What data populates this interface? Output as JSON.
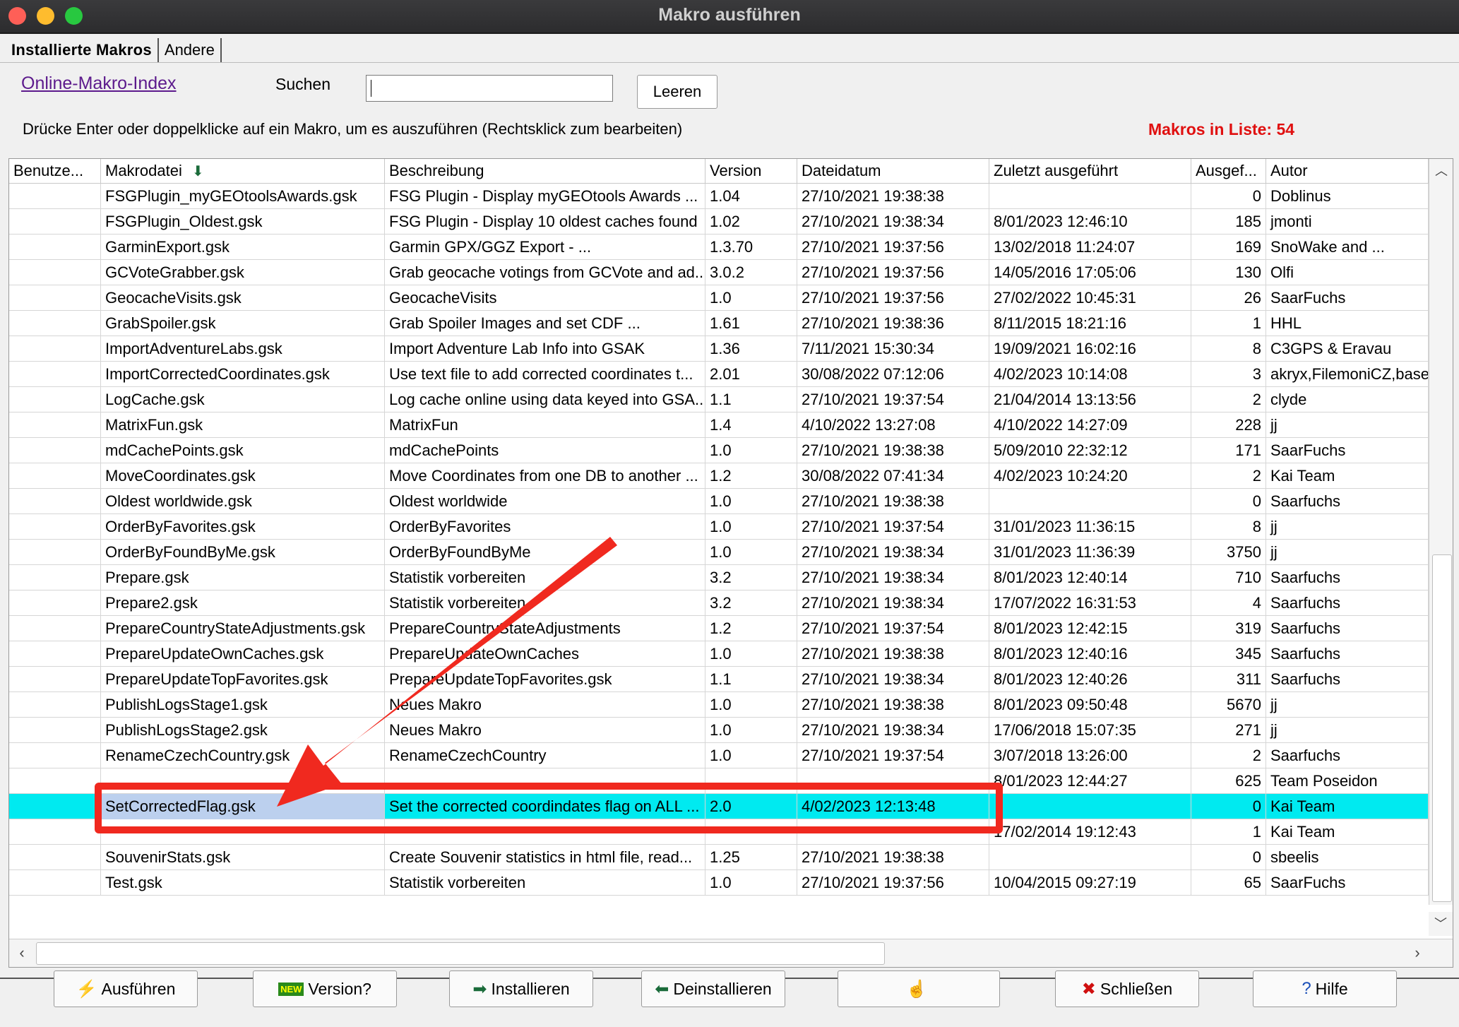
{
  "window": {
    "title": "Makro ausführen"
  },
  "tabs": [
    {
      "label": "Installierte Makros"
    },
    {
      "label": "Andere"
    }
  ],
  "online_link": "Online-Makro-Index",
  "search": {
    "label": "Suchen",
    "value": "",
    "clear_label": "Leeren"
  },
  "hint": "Drücke Enter oder doppelklicke auf ein Makro, um es auszuführen (Rechtsklick zum bearbeiten)",
  "count_text": "Makros in Liste: 54",
  "columns": [
    "Benutze...",
    "Makrodatei",
    "Beschreibung",
    "Version",
    "Dateidatum",
    "Zuletzt ausgeführt",
    "Ausgef...",
    "Autor"
  ],
  "rows": [
    {
      "user": "",
      "file": "FSGPlugin_myGEOtoolsAwards.gsk",
      "desc": "FSG Plugin - Display myGEOtools Awards ...",
      "ver": "1.04",
      "date": "27/10/2021 19:38:38",
      "last": "",
      "runs": "0",
      "author": "Doblinus"
    },
    {
      "user": "",
      "file": "FSGPlugin_Oldest.gsk",
      "desc": "FSG Plugin - Display 10 oldest caches found",
      "ver": "1.02",
      "date": "27/10/2021 19:38:34",
      "last": "8/01/2023 12:46:10",
      "runs": "185",
      "author": "jmonti"
    },
    {
      "user": "",
      "file": "GarminExport.gsk",
      "desc": "Garmin GPX/GGZ Export  - ...",
      "ver": "1.3.70",
      "date": "27/10/2021 19:37:56",
      "last": "13/02/2018 11:24:07",
      "runs": "169",
      "author": "SnoWake and ..."
    },
    {
      "user": "",
      "file": "GCVoteGrabber.gsk",
      "desc": "Grab geocache votings from GCVote and ad...",
      "ver": "3.0.2",
      "date": "27/10/2021 19:37:56",
      "last": "14/05/2016 17:05:06",
      "runs": "130",
      "author": "Olfi"
    },
    {
      "user": "",
      "file": "GeocacheVisits.gsk",
      "desc": "GeocacheVisits",
      "ver": "1.0",
      "date": "27/10/2021 19:37:56",
      "last": "27/02/2022 10:45:31",
      "runs": "26",
      "author": "SaarFuchs"
    },
    {
      "user": "",
      "file": "GrabSpoiler.gsk",
      "desc": "Grab Spoiler Images and set CDF ...",
      "ver": "1.61",
      "date": "27/10/2021 19:38:36",
      "last": "8/11/2015 18:21:16",
      "runs": "1",
      "author": "HHL"
    },
    {
      "user": "",
      "file": "ImportAdventureLabs.gsk",
      "desc": "Import Adventure Lab Info into GSAK",
      "ver": "1.36",
      "date": "7/11/2021 15:30:34",
      "last": "19/09/2021 16:02:16",
      "runs": "8",
      "author": "C3GPS & Eravau"
    },
    {
      "user": "",
      "file": "ImportCorrectedCoordinates.gsk",
      "desc": "Use text file to add corrected coordinates t...",
      "ver": "2.01",
      "date": "30/08/2022 07:12:06",
      "last": "4/02/2023 10:14:08",
      "runs": "3",
      "author": "akryx,FilemoniCZ,basec"
    },
    {
      "user": "",
      "file": "LogCache.gsk",
      "desc": "Log cache online using data keyed into GSA...",
      "ver": "1.1",
      "date": "27/10/2021 19:37:54",
      "last": "21/04/2014 13:13:56",
      "runs": "2",
      "author": "clyde"
    },
    {
      "user": "",
      "file": "MatrixFun.gsk",
      "desc": "MatrixFun",
      "ver": "1.4",
      "date": "4/10/2022 13:27:08",
      "last": "4/10/2022 14:27:09",
      "runs": "228",
      "author": "jj"
    },
    {
      "user": "",
      "file": "mdCachePoints.gsk",
      "desc": "mdCachePoints",
      "ver": "1.0",
      "date": "27/10/2021 19:38:38",
      "last": "5/09/2010 22:32:12",
      "runs": "171",
      "author": "SaarFuchs"
    },
    {
      "user": "",
      "file": "MoveCoordinates.gsk",
      "desc": "Move Coordinates from one DB to another ...",
      "ver": "1.2",
      "date": "30/08/2022 07:41:34",
      "last": "4/02/2023 10:24:20",
      "runs": "2",
      "author": "Kai Team"
    },
    {
      "user": "",
      "file": "Oldest worldwide.gsk",
      "desc": "Oldest worldwide",
      "ver": "1.0",
      "date": "27/10/2021 19:38:38",
      "last": "",
      "runs": "0",
      "author": "Saarfuchs"
    },
    {
      "user": "",
      "file": "OrderByFavorites.gsk",
      "desc": "OrderByFavorites",
      "ver": "1.0",
      "date": "27/10/2021 19:37:54",
      "last": "31/01/2023 11:36:15",
      "runs": "8",
      "author": "jj"
    },
    {
      "user": "",
      "file": "OrderByFoundByMe.gsk",
      "desc": "OrderByFoundByMe",
      "ver": "1.0",
      "date": "27/10/2021 19:38:34",
      "last": "31/01/2023 11:36:39",
      "runs": "3750",
      "author": "jj"
    },
    {
      "user": "",
      "file": "Prepare.gsk",
      "desc": "Statistik vorbereiten",
      "ver": "3.2",
      "date": "27/10/2021 19:38:34",
      "last": "8/01/2023 12:40:14",
      "runs": "710",
      "author": "Saarfuchs"
    },
    {
      "user": "",
      "file": "Prepare2.gsk",
      "desc": "Statistik vorbereiten",
      "ver": "3.2",
      "date": "27/10/2021 19:38:34",
      "last": "17/07/2022 16:31:53",
      "runs": "4",
      "author": "Saarfuchs"
    },
    {
      "user": "",
      "file": "PrepareCountryStateAdjustments.gsk",
      "desc": "PrepareCountryStateAdjustments",
      "ver": "1.2",
      "date": "27/10/2021 19:37:54",
      "last": "8/01/2023 12:42:15",
      "runs": "319",
      "author": "Saarfuchs"
    },
    {
      "user": "",
      "file": "PrepareUpdateOwnCaches.gsk",
      "desc": "PrepareUpdateOwnCaches",
      "ver": "1.0",
      "date": "27/10/2021 19:38:38",
      "last": "8/01/2023 12:40:16",
      "runs": "345",
      "author": "Saarfuchs"
    },
    {
      "user": "",
      "file": "PrepareUpdateTopFavorites.gsk",
      "desc": "PrepareUpdateTopFavorites.gsk",
      "ver": "1.1",
      "date": "27/10/2021 19:38:34",
      "last": "8/01/2023 12:40:26",
      "runs": "311",
      "author": "Saarfuchs"
    },
    {
      "user": "",
      "file": "PublishLogsStage1.gsk",
      "desc": "Neues Makro",
      "ver": "1.0",
      "date": "27/10/2021 19:38:38",
      "last": "8/01/2023 09:50:48",
      "runs": "5670",
      "author": "jj"
    },
    {
      "user": "",
      "file": "PublishLogsStage2.gsk",
      "desc": "Neues Makro",
      "ver": "1.0",
      "date": "27/10/2021 19:38:34",
      "last": "17/06/2018 15:07:35",
      "runs": "271",
      "author": "jj"
    },
    {
      "user": "",
      "file": "RenameCzechCountry.gsk",
      "desc": "RenameCzechCountry",
      "ver": "1.0",
      "date": "27/10/2021 19:37:54",
      "last": "3/07/2018 13:26:00",
      "runs": "2",
      "author": "Saarfuchs"
    },
    {
      "user": "",
      "file": "",
      "desc": "",
      "ver": "",
      "date": "",
      "last": "8/01/2023 12:44:27",
      "runs": "625",
      "author": "Team Poseidon"
    },
    {
      "user": "",
      "file": "SetCorrectedFlag.gsk",
      "desc": "Set the corrected coordindates flag on ALL ...",
      "ver": "2.0",
      "date": "4/02/2023 12:13:48",
      "last": "",
      "runs": "0",
      "author": "Kai Team",
      "selected": true
    },
    {
      "user": "",
      "file": "",
      "desc": "",
      "ver": "",
      "date": "",
      "last": "17/02/2014 19:12:43",
      "runs": "1",
      "author": "Kai Team"
    },
    {
      "user": "",
      "file": "SouvenirStats.gsk",
      "desc": "Create Souvenir statistics in html file, read...",
      "ver": "1.25",
      "date": "27/10/2021 19:38:38",
      "last": "",
      "runs": "0",
      "author": "sbeelis"
    },
    {
      "user": "",
      "file": "Test.gsk",
      "desc": "Statistik vorbereiten",
      "ver": "1.0",
      "date": "27/10/2021 19:37:56",
      "last": "10/04/2015 09:27:19",
      "runs": "65",
      "author": "SaarFuchs"
    }
  ],
  "buttons": [
    {
      "label": "Ausführen",
      "icon": "lightning-icon",
      "glyph": "⚡",
      "color": "#d4a000"
    },
    {
      "label": "Version?",
      "icon": "new-badge-icon",
      "glyph": "NEW",
      "color": "#2a8a1a"
    },
    {
      "label": "Installieren",
      "icon": "arrow-right-icon",
      "glyph": "➡",
      "color": "#1a6b3a"
    },
    {
      "label": "Deinstallieren",
      "icon": "arrow-left-icon",
      "glyph": "⬅",
      "color": "#1a6b3a"
    },
    {
      "label": "",
      "icon": "person-icon",
      "glyph": "☝",
      "color": "#d4a000"
    },
    {
      "label": "Schließen",
      "icon": "close-icon",
      "glyph": "✖",
      "color": "#d01010"
    },
    {
      "label": "Hilfe",
      "icon": "help-icon",
      "glyph": "?",
      "color": "#1a4fb8"
    }
  ],
  "colors": {
    "selected_row": "#00eaf0",
    "annotation": "#f0291f",
    "count_text": "#e01010"
  }
}
